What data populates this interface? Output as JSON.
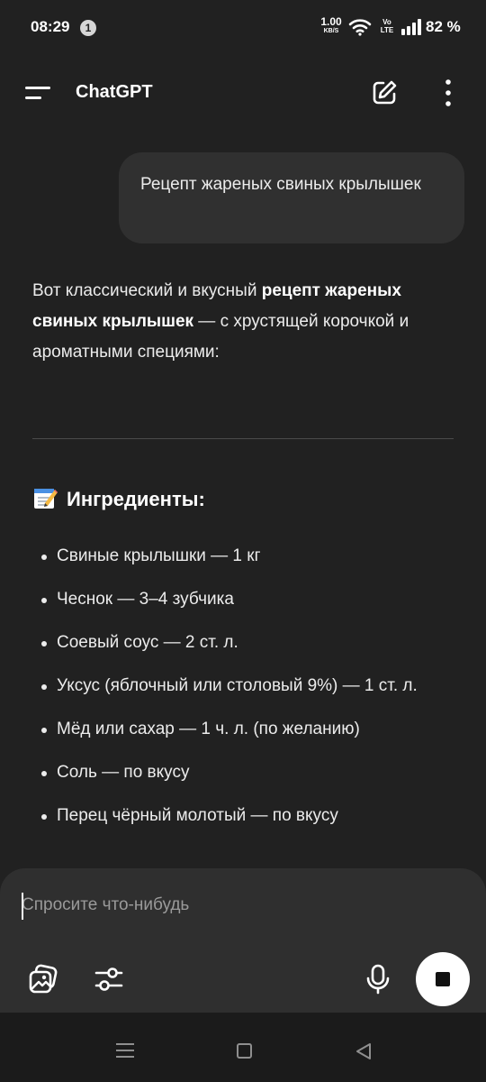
{
  "status_bar": {
    "time": "08:29",
    "notification_count": "1",
    "net_speed_value": "1.00",
    "net_speed_unit": "KB/S",
    "volte_top": "Vo",
    "volte_bottom": "LTE",
    "battery": "82 %"
  },
  "header": {
    "title": "ChatGPT",
    "icons": [
      "menu-icon",
      "new-chat-icon",
      "more-vertical-icon"
    ]
  },
  "conversation": {
    "user_message": "Рецепт жареных свиных крылышек",
    "assistant_intro": {
      "before": "Вот классический и вкусный ",
      "bold": "рецепт жареных свиных крылышек",
      "after": " — с хрустящей корочкой и ароматными специями:"
    },
    "section_heading": "Ингредиенты:",
    "section_icon": "memo-icon",
    "ingredients": [
      "Свиные крылышки — 1 кг",
      "Чеснок — 3–4 зубчика",
      "Соевый соус — 2 ст. л.",
      "Уксус (яблочный или столовый 9%) — 1 ст. л.",
      "Мёд или сахар — 1 ч. л. (по желанию)",
      "Соль — по вкусу",
      "Перец чёрный молотый — по вкусу"
    ]
  },
  "composer": {
    "placeholder": "Спросите что-нибудь",
    "value": "",
    "icons": [
      "image-attach-icon",
      "tools-sliders-icon",
      "mic-icon",
      "stop-icon"
    ]
  },
  "nav_bar": {
    "icons": [
      "recent-apps-icon",
      "home-icon",
      "back-icon"
    ]
  },
  "colors": {
    "background": "#212121",
    "bubble": "#303030",
    "composer": "#2f2f2f",
    "text": "#ececec",
    "stop_button": "#ffffff"
  }
}
